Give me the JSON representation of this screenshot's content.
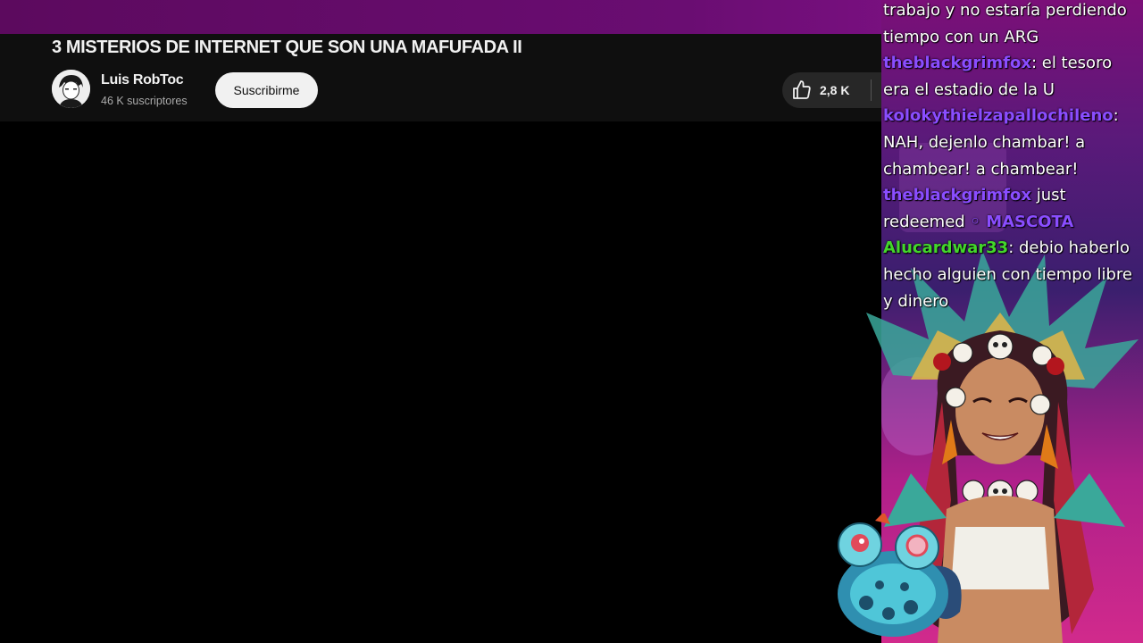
{
  "video": {
    "title": "3 MISTERIOS DE INTERNET QUE SON UNA MAFUFADA II",
    "channel_name": "Luis RobToc",
    "subscribers": "46 K suscriptores",
    "subscribe_label": "Suscribirme",
    "likes": "2,8 K"
  },
  "chat": {
    "lines": [
      {
        "segments": [
          {
            "text": "trabajo y no estaría perdiendo tiempo con un ARG",
            "color": "#ffffff"
          }
        ]
      },
      {
        "segments": [
          {
            "text": "theblackgrimfox",
            "color": "#8a4dff",
            "user": true
          },
          {
            "text": ": el tesoro era el estadio de la U",
            "color": "#ffffff"
          }
        ]
      },
      {
        "segments": [
          {
            "text": "kolokythielzapallochileno",
            "color": "#8a4dff",
            "user": true
          },
          {
            "text": ": NAH, dejenlo chambar! a chambear! a chambear!",
            "color": "#ffffff"
          }
        ]
      },
      {
        "segments": [
          {
            "text": "theblackgrimfox",
            "color": "#8a4dff",
            "user": true
          },
          {
            "text": " just redeemed ",
            "color": "#ffffff"
          },
          {
            "text": "◦ MASCOTA",
            "color": "#8a4dff",
            "user": true
          }
        ]
      },
      {
        "segments": [
          {
            "text": "Alucardwar33",
            "color": "#43d62b",
            "user": true
          },
          {
            "text": ": debio haberlo hecho alguien con tiempo libre y dinero",
            "color": "#ffffff"
          }
        ]
      }
    ]
  },
  "colors": {
    "accent_purple": "#8a4dff",
    "accent_green": "#43d62b",
    "yt_panel": "#0f0f0f"
  }
}
